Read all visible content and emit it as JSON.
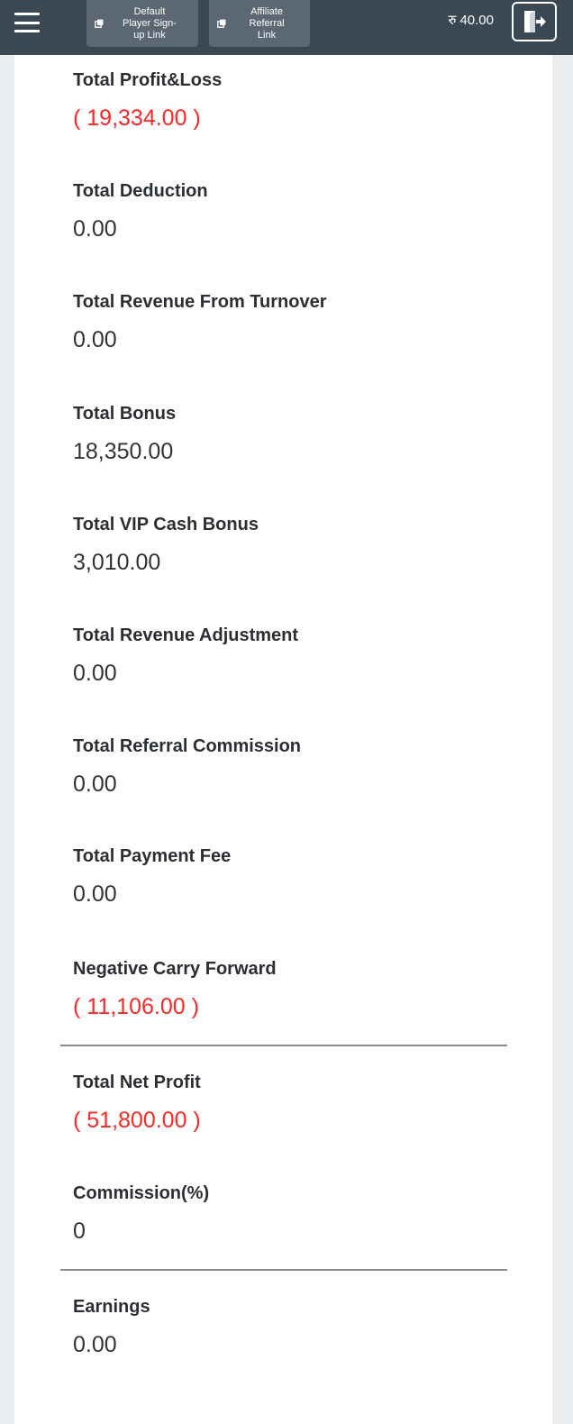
{
  "header": {
    "links": [
      {
        "label": "Default\nPlayer Sign-\nup Link",
        "icon": "external-link-icon"
      },
      {
        "label": "Affiliate\nReferral\nLink",
        "icon": "external-link-icon"
      }
    ],
    "currency_symbol": "रु",
    "balance": "40.00",
    "colors": {
      "bar": "#3a4854",
      "button": "#5b6873"
    }
  },
  "stats": [
    {
      "label": "Total Profit&Loss",
      "value": "( 19,334.00 )",
      "negative": true
    },
    {
      "label": "Total Deduction",
      "value": "0.00",
      "negative": false
    },
    {
      "label": "Total Revenue From Turnover",
      "value": "0.00",
      "negative": false
    },
    {
      "label": "Total Bonus",
      "value": "18,350.00",
      "negative": false
    },
    {
      "label": "Total VIP Cash Bonus",
      "value": "3,010.00",
      "negative": false
    },
    {
      "label": "Total Revenue Adjustment",
      "value": "0.00",
      "negative": false
    },
    {
      "label": "Total Referral Commission",
      "value": "0.00",
      "negative": false
    },
    {
      "label": "Total Payment Fee",
      "value": "0.00",
      "negative": false
    },
    {
      "label": "Negative Carry Forward",
      "value": "( 11,106.00 )",
      "negative": true
    },
    {
      "label": "Total Net Profit",
      "value": "( 51,800.00 )",
      "negative": true
    },
    {
      "label": "Commission(%)",
      "value": "0",
      "negative": false
    },
    {
      "label": "Earnings",
      "value": "0.00",
      "negative": false
    }
  ],
  "colors": {
    "negative": "#ff2626",
    "label": "#2b2f33",
    "value": "#333333"
  }
}
